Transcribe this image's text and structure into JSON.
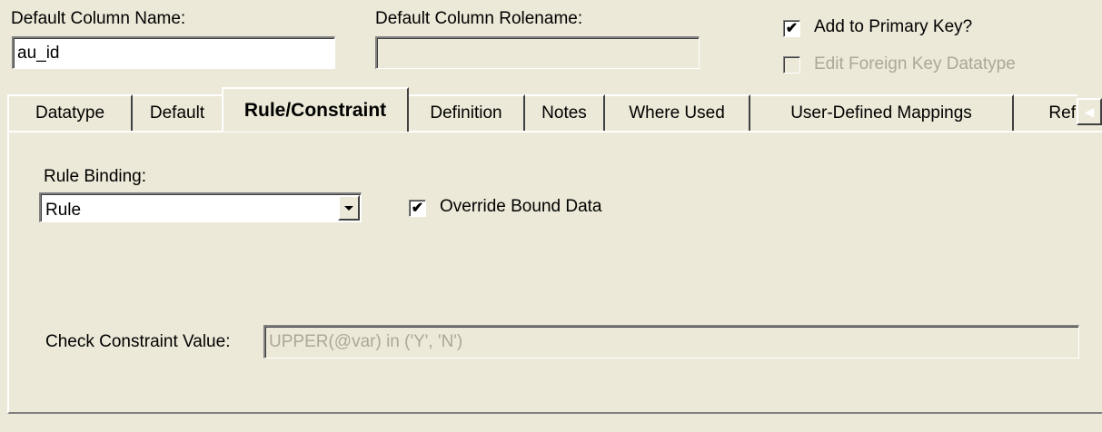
{
  "header": {
    "default_column_name_label": "Default Column Name:",
    "default_column_name_value": "au_id",
    "default_column_rolename_label": "Default Column Rolename:",
    "default_column_rolename_value": "",
    "add_to_primary_key_label": "Add to Primary Key?",
    "add_to_primary_key_checked": true,
    "edit_foreign_key_label": "Edit Foreign Key Datatype",
    "edit_foreign_key_checked": false,
    "check_mark": "✔"
  },
  "tabs": [
    {
      "label": "Datatype",
      "active": false
    },
    {
      "label": "Default",
      "active": false
    },
    {
      "label": "Rule/Constraint",
      "active": true
    },
    {
      "label": "Definition",
      "active": false
    },
    {
      "label": "Notes",
      "active": false
    },
    {
      "label": "Where Used",
      "active": false
    },
    {
      "label": "User-Defined Mappings",
      "active": false
    },
    {
      "label": "Ref",
      "active": false
    }
  ],
  "rule_panel": {
    "rule_binding_label": "Rule Binding:",
    "rule_binding_value": "Rule",
    "override_bound_data_label": "Override Bound Data",
    "override_bound_data_checked": true,
    "check_constraint_label": "Check Constraint Value:",
    "check_constraint_value": "UPPER(@var) in ('Y', 'N')"
  },
  "icons": {
    "tab_scroll": "tab-scroll-left-icon",
    "dropdown": "chevron-down-icon",
    "checkmark": "checkmark-icon"
  },
  "colors": {
    "background": "#ECE9D8",
    "disabled_text": "#ACA899",
    "field_bg": "#FFFFFF"
  }
}
